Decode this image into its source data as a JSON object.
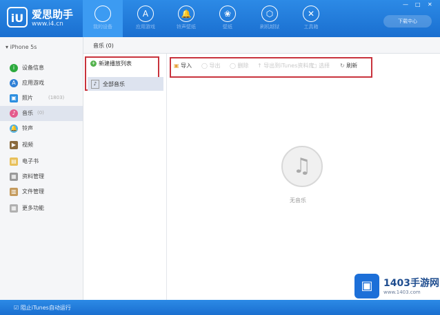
{
  "app": {
    "logo_text": "iU",
    "title": "爱思助手",
    "url": "www.i4.cn"
  },
  "nav": [
    {
      "label": "我的设备",
      "icon": ""
    },
    {
      "label": "应用游戏",
      "icon": "A"
    },
    {
      "label": "铃声壁纸",
      "icon": "🔔"
    },
    {
      "label": "壁纸",
      "icon": "❀"
    },
    {
      "label": "刷机越狱",
      "icon": "⬡"
    },
    {
      "label": "工具箱",
      "icon": "✕"
    }
  ],
  "window_controls": [
    "—",
    "□",
    "✕"
  ],
  "topright_button": "下载中心",
  "device": {
    "name": "iPhone 5s"
  },
  "sidebar": {
    "items": [
      {
        "label": "设备信息",
        "count": "",
        "color": "#2daa3e",
        "icon": "i"
      },
      {
        "label": "应用游戏",
        "count": "",
        "color": "#2f80d6",
        "icon": "A"
      },
      {
        "label": "照片",
        "count": "(1803)",
        "color": "#2d8fe0",
        "icon": "▣"
      },
      {
        "label": "音乐",
        "count": "(0)",
        "color": "#e45b8c",
        "icon": "♪"
      },
      {
        "label": "铃声",
        "count": "",
        "color": "#4fb1e6",
        "icon": "🔔"
      },
      {
        "label": "视频",
        "count": "",
        "color": "#8a6a3d",
        "icon": "▶"
      },
      {
        "label": "电子书",
        "count": "",
        "color": "#e8c05a",
        "icon": "▤"
      },
      {
        "label": "资料管理",
        "count": "",
        "color": "#999999",
        "icon": "▦"
      },
      {
        "label": "文件管理",
        "count": "",
        "color": "#c49a5c",
        "icon": "▥"
      },
      {
        "label": "更多功能",
        "count": "",
        "color": "#b0b0b0",
        "icon": "▦"
      }
    ]
  },
  "tabs": [
    {
      "label": "音乐 (0)"
    }
  ],
  "playlist": {
    "new_label": "新建播放列表",
    "all_music_label": "全部音乐"
  },
  "toolbar": {
    "import": "导入",
    "export": "导出",
    "delete": "删除",
    "transfer": "导出到iTunes资料库",
    "select": "选择",
    "refresh": "刷新"
  },
  "empty": {
    "text": "无音乐"
  },
  "status": {
    "text": "阻止iTunes自动运行"
  },
  "watermark": {
    "title": "1403手游网",
    "url": "www.1403.com"
  }
}
